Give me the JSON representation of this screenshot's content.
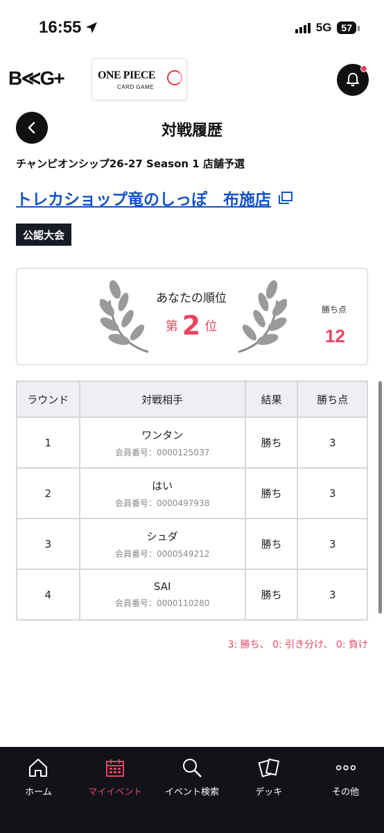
{
  "status_bar": {
    "time": "16:55",
    "network": "5G",
    "battery": "57"
  },
  "header": {
    "app_logo": "B≪G+",
    "op_title": "ONE PIECE",
    "op_subtitle": "CARD GAME"
  },
  "page": {
    "title": "対戦履歴",
    "event_name": "チャンピオンシップ26-27 Season 1 店舗予選",
    "shop_name": "トレカショップ竜のしっぽ　布施店",
    "badge": "公認大会"
  },
  "rank_card": {
    "label": "あなたの順位",
    "rank_prefix": "第",
    "rank": "2",
    "rank_suffix": "位",
    "points_label": "勝ち点",
    "points": "12"
  },
  "table": {
    "headers": [
      "ラウンド",
      "対戦相手",
      "結果",
      "勝ち点"
    ],
    "rows": [
      {
        "round": "1",
        "opponent": "ワンタン",
        "member_id": "会員番号：0000125037",
        "result": "勝ち",
        "points": "3"
      },
      {
        "round": "2",
        "opponent": "はい",
        "member_id": "会員番号：0000497938",
        "result": "勝ち",
        "points": "3"
      },
      {
        "round": "3",
        "opponent": "シュダ",
        "member_id": "会員番号：0000549212",
        "result": "勝ち",
        "points": "3"
      },
      {
        "round": "4",
        "opponent": "SAI",
        "member_id": "会員番号：0000110280",
        "result": "勝ち",
        "points": "3"
      }
    ]
  },
  "legend": "3: 勝ち、 0: 引き分け、 0: 負け",
  "nav": [
    {
      "label": "ホーム",
      "icon": "home-icon"
    },
    {
      "label": "マイイベント",
      "icon": "calendar-icon"
    },
    {
      "label": "イベント検索",
      "icon": "search-icon"
    },
    {
      "label": "デッキ",
      "icon": "cards-icon"
    },
    {
      "label": "その他",
      "icon": "more-icon"
    }
  ],
  "colors": {
    "accent": "#e94560",
    "link": "#1453c9",
    "dark": "#111319"
  }
}
